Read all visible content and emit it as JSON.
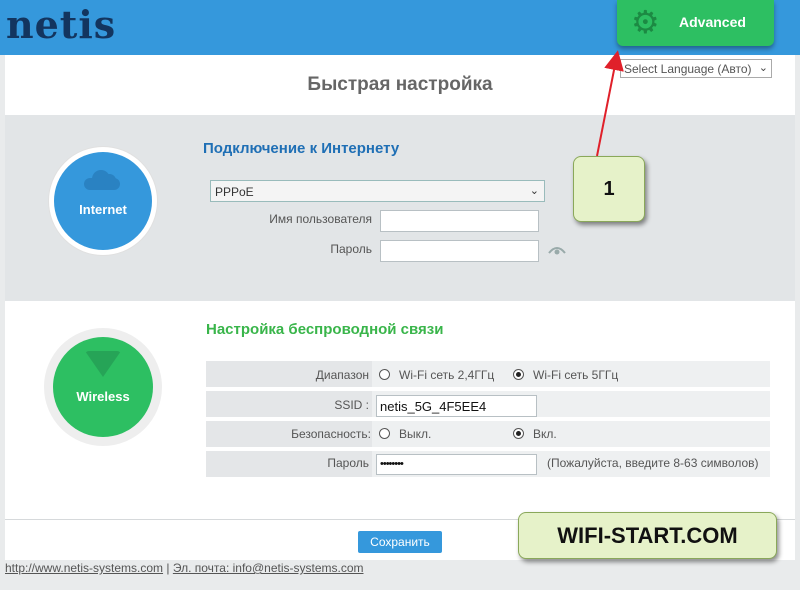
{
  "brand": {
    "logo": "netis"
  },
  "header": {
    "advanced_label": "Advanced",
    "language_select": "Select Language (Авто)"
  },
  "page_title": "Быстрая настройка",
  "internet": {
    "circle_label": "Internet",
    "heading": "Подключение к Интернету",
    "connection_type": "PPPoE",
    "username_label": "Имя пользователя",
    "username_value": "",
    "password_label": "Пароль",
    "password_value": ""
  },
  "wireless": {
    "circle_label": "Wireless",
    "heading": "Настройка беспроводной связи",
    "band_label": "Диапазон",
    "band_options": [
      "Wi-Fi сеть 2,4ГГц",
      "Wi-Fi сеть 5ГГц"
    ],
    "band_selected": "Wi-Fi сеть 5ГГц",
    "ssid_label": "SSID :",
    "ssid_value": "netis_5G_4F5EE4",
    "security_label": "Безопасность:",
    "security_options": [
      "Выкл.",
      "Вкл."
    ],
    "security_selected": "Вкл.",
    "password_label": "Пароль",
    "password_value": "••••••••",
    "password_hint": "(Пожалуйста, введите 8-63 символов)"
  },
  "save_label": "Сохранить",
  "footer": {
    "url": "http://www.netis-systems.com",
    "separator": "|",
    "email": "Эл. почта: info@netis-systems.com"
  },
  "annotations": {
    "callout_1": "1",
    "watermark": "WIFI-START.COM"
  },
  "colors": {
    "header": "#3598dc",
    "advanced": "#2dbf62",
    "logo": "#13355f",
    "callout_bg": "#e6f2c9",
    "arrow": "#e0202a"
  }
}
